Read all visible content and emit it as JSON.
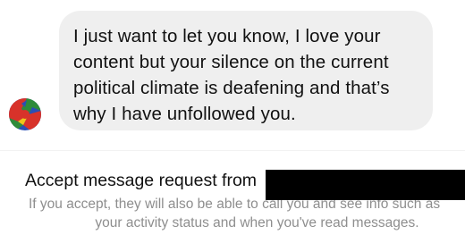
{
  "conversation": {
    "message": {
      "lines": [
        "I just want to let you know, I love your",
        "content but your silence on the current",
        "political climate is deafening and that’s",
        "why I have unfollowed you."
      ]
    },
    "avatar_colors": {
      "red": "#d8322a",
      "green": "#2e8b3a",
      "blue": "#2a4fb5"
    }
  },
  "message_request": {
    "title": "Accept message request from",
    "sender_name_redacted": true,
    "description_line1": "If you accept, they will also be able to call you and see info such as",
    "description_line2": "your activity status and when you've read messages."
  }
}
